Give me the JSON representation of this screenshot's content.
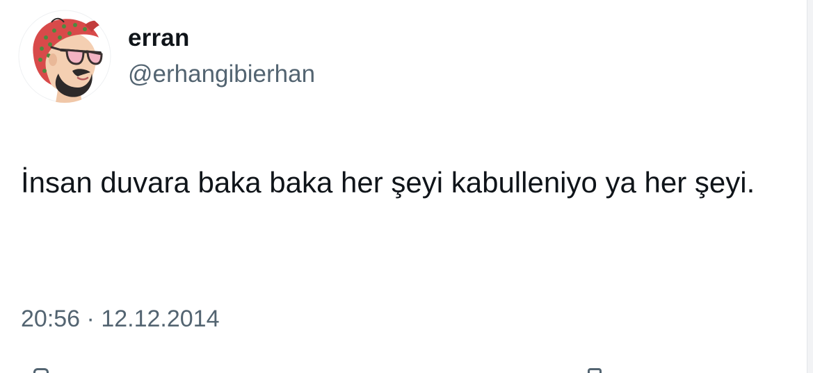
{
  "user": {
    "display_name": "erran",
    "handle": "@erhangibierhan",
    "avatar_icon": "bearded-man-bandana-sunglasses-avatar"
  },
  "tweet": {
    "text": "İnsan duvara baka baka her şeyi kabulleniyo ya her şeyi.",
    "time": "20:56",
    "separator": "·",
    "date": "12.12.2014"
  },
  "colors": {
    "text_primary": "#0f1419",
    "text_secondary": "#536471",
    "bandana": "#d84a4a",
    "bandana_dots": "#4d8a3f",
    "sunglasses_lens": "#f2b3c2",
    "skin": "#f0c7a8",
    "beard": "#2e2a2a"
  }
}
